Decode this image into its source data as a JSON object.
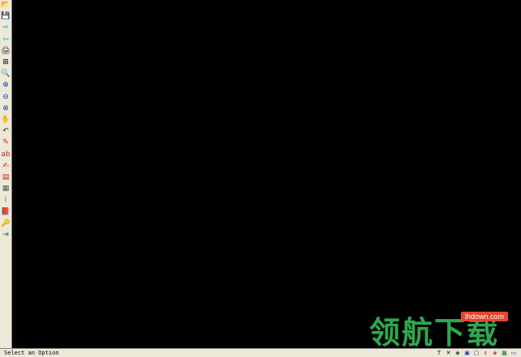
{
  "status": {
    "text": "Select an Option"
  },
  "toolbar": {
    "tools": [
      {
        "name": "open-icon",
        "glyph": "📂",
        "color": "#c9a227"
      },
      {
        "name": "save-icon",
        "glyph": "💾",
        "color": "#1e3f9a"
      },
      {
        "name": "forward-arrow-icon",
        "glyph": "⇨",
        "color": "#11a0b0"
      },
      {
        "name": "back-arrow-icon",
        "glyph": "⇦",
        "color": "#11a0b0"
      },
      {
        "name": "print-icon",
        "glyph": "🖨",
        "color": "#333333"
      },
      {
        "name": "plotter-icon",
        "glyph": "⊞",
        "color": "#000000"
      },
      {
        "name": "search-icon",
        "glyph": "🔍",
        "color": "#333333"
      },
      {
        "name": "zoom-in-icon",
        "glyph": "⊕",
        "color": "#1e3f9a"
      },
      {
        "name": "zoom-out-icon",
        "glyph": "⊖",
        "color": "#1e3f9a"
      },
      {
        "name": "zoom-window-icon",
        "glyph": "⊗",
        "color": "#1e3f9a"
      },
      {
        "name": "pan-hand-icon",
        "glyph": "✋",
        "color": "#333333"
      },
      {
        "name": "undo-icon",
        "glyph": "↶",
        "color": "#333333"
      },
      {
        "name": "draw-pencil-icon",
        "glyph": "✎",
        "color": "#cc2222"
      },
      {
        "name": "text-icon",
        "glyph": "ab",
        "color": "#cc2222"
      },
      {
        "name": "edit-text-icon",
        "glyph": "✍",
        "color": "#cc2222"
      },
      {
        "name": "layer-icon",
        "glyph": "▤",
        "color": "#cc2222"
      },
      {
        "name": "grid-icon",
        "glyph": "▦",
        "color": "#555555"
      },
      {
        "name": "info-icon",
        "glyph": "i",
        "color": "#11886e"
      },
      {
        "name": "book-icon",
        "glyph": "📕",
        "color": "#8b2a8b"
      },
      {
        "name": "key-icon",
        "glyph": "🔑",
        "color": "#b08a10"
      },
      {
        "name": "exit-icon",
        "glyph": "⇥",
        "color": "#1e7a2e"
      }
    ]
  },
  "statusbar_buttons": [
    {
      "name": "text-tool-icon",
      "glyph": "T",
      "color": "#000000"
    },
    {
      "name": "cancel-icon",
      "glyph": "✕",
      "color": "#000000"
    },
    {
      "name": "shield-icon",
      "glyph": "◆",
      "color": "#1e7a2e"
    },
    {
      "name": "window-icon",
      "glyph": "▣",
      "color": "#1e3f9a"
    },
    {
      "name": "snap-icon",
      "glyph": "▢",
      "color": "#333333"
    },
    {
      "name": "ortho-icon",
      "glyph": "ɛ",
      "color": "#cc2222"
    },
    {
      "name": "layers-icon",
      "glyph": "◈",
      "color": "#cc2222"
    },
    {
      "name": "object-snap-icon",
      "glyph": "▩",
      "color": "#1e7a2e"
    },
    {
      "name": "monitor-icon",
      "glyph": "▭",
      "color": "#1e3f9a"
    }
  ],
  "watermark": {
    "brand": "领航下载",
    "url": "lhdown.com"
  }
}
